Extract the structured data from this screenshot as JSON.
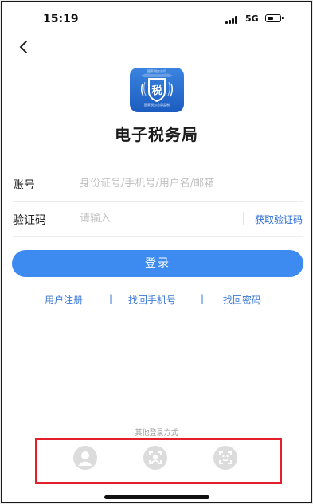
{
  "status_bar": {
    "time": "15:19",
    "network": "5G",
    "battery_percent": 55,
    "signal_bars": 4
  },
  "logo": {
    "top_text": "国家税务总局",
    "glyph": "税",
    "bottom_text": "国家税务总局监制"
  },
  "app": {
    "title": "电子税务局"
  },
  "form": {
    "account_label": "账号",
    "account_placeholder": "身份证号/手机号/用户名/邮箱",
    "code_label": "验证码",
    "code_placeholder": "请输入",
    "get_code_label": "获取验证码"
  },
  "login_button": "登录",
  "links": {
    "register": "用户注册",
    "separator": "|",
    "recover_phone": "找回手机号",
    "recover_password": "找回密码"
  },
  "other_login": {
    "title": "其他登录方式",
    "options": [
      {
        "icon": "person-icon"
      },
      {
        "icon": "face-scan-icon"
      },
      {
        "icon": "face-id-icon"
      }
    ]
  },
  "colors": {
    "accent": "#3d8af0",
    "link": "#3a78d8",
    "highlight": "#e3202a"
  }
}
